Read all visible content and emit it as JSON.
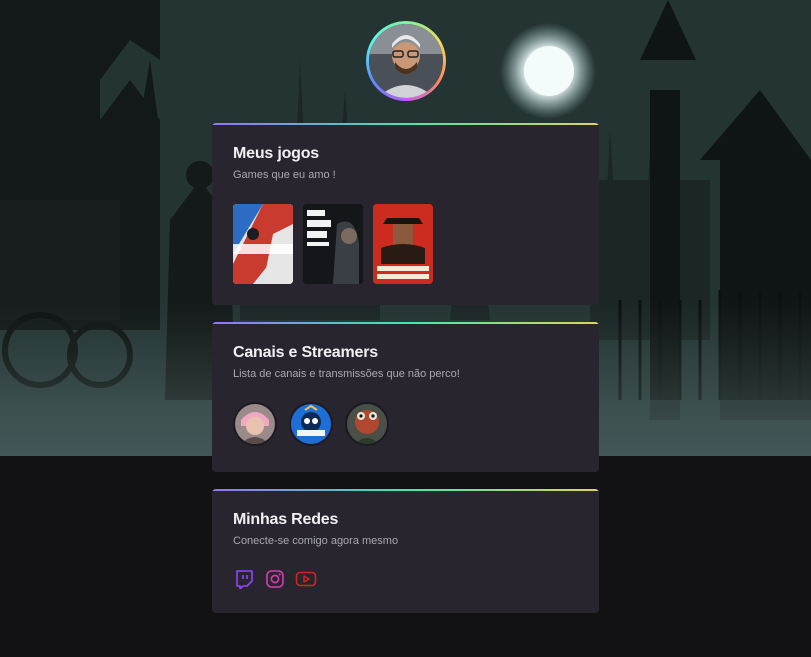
{
  "profile": {
    "avatar_icon": "user-avatar-photo"
  },
  "sections": {
    "games": {
      "title": "Meus jogos",
      "subtitle": "Games que eu amo !",
      "items": [
        {
          "icon": "rainbow-six-siege-cover"
        },
        {
          "icon": "the-last-of-us-part-ii-cover"
        },
        {
          "icon": "red-dead-redemption-ii-cover"
        }
      ]
    },
    "streamers": {
      "title": "Canais e Streamers",
      "subtitle": "Lista de canais e transmissões que não perco!",
      "items": [
        {
          "icon": "streamer-avatar-1"
        },
        {
          "icon": "streamer-avatar-2"
        },
        {
          "icon": "streamer-avatar-3"
        }
      ]
    },
    "socials": {
      "title": "Minhas Redes",
      "subtitle": "Conecte-se comigo agora mesmo",
      "items": [
        {
          "icon": "twitch-icon",
          "color": "#9146ff"
        },
        {
          "icon": "instagram-icon",
          "color": "#d43fb6"
        },
        {
          "icon": "youtube-icon",
          "color": "#d1241f"
        }
      ]
    }
  },
  "colors": {
    "card_bg": "#29252f",
    "page_bg": "#121214",
    "accent_gradient": [
      "#9572fc",
      "#43e7ad",
      "#e2d45c"
    ]
  }
}
